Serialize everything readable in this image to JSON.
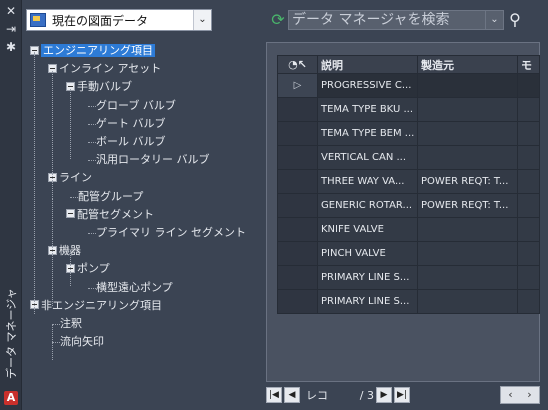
{
  "palette": {
    "title": "データ マネージャ",
    "toolbar_icons": [
      "close-icon",
      "pin-icon",
      "properties-icon"
    ],
    "app_logo_letter": "A"
  },
  "drawing_selector": {
    "value": "現在の図面データ"
  },
  "search": {
    "placeholder": "データ マネージャを検索"
  },
  "tree": [
    {
      "label": "エンジニアリング項目",
      "level": 0,
      "toggle": true,
      "selected": true
    },
    {
      "label": "インライン アセット",
      "level": 1,
      "toggle": true
    },
    {
      "label": "手動バルブ",
      "level": 2,
      "toggle": true
    },
    {
      "label": "グローブ バルブ",
      "level": 3
    },
    {
      "label": "ゲート バルブ",
      "level": 3
    },
    {
      "label": "ボール バルブ",
      "level": 3
    },
    {
      "label": "汎用ロータリー バルブ",
      "level": 3
    },
    {
      "label": "ライン",
      "level": 1,
      "toggle": true
    },
    {
      "label": "配管グループ",
      "level": 2
    },
    {
      "label": "配管セグメント",
      "level": 2,
      "toggle": true
    },
    {
      "label": "プライマリ ライン セグメント",
      "level": 3
    },
    {
      "label": "機器",
      "level": 1,
      "toggle": true
    },
    {
      "label": "ポンプ",
      "level": 2,
      "toggle": true
    },
    {
      "label": "横型遠心ポンプ",
      "level": 3
    },
    {
      "label": "非エンジニアリング項目",
      "level": 0,
      "toggle": true
    },
    {
      "label": "注釈",
      "level": 1
    },
    {
      "label": "流向矢印",
      "level": 1
    }
  ],
  "grid": {
    "columns": [
      "説明",
      "製造元",
      "モ"
    ],
    "rows": [
      [
        "PROGRESSIVE C...",
        "",
        ""
      ],
      [
        "TEMA TYPE BKU ...",
        "",
        ""
      ],
      [
        "TEMA TYPE BEM ...",
        "",
        ""
      ],
      [
        "VERTICAL CAN ...",
        "",
        ""
      ],
      [
        "THREE WAY VA...",
        "POWER REQT: T...",
        ""
      ],
      [
        "GENERIC ROTAR...",
        "POWER REQT: T...",
        ""
      ],
      [
        "KNIFE VALVE",
        "",
        ""
      ],
      [
        "PINCH VALVE",
        "",
        ""
      ],
      [
        "PRIMARY LINE S...",
        "",
        ""
      ],
      [
        "PRIMARY LINE S...",
        "",
        ""
      ]
    ]
  },
  "pager": {
    "record_label": "レコ",
    "count_text": "/ 3"
  }
}
